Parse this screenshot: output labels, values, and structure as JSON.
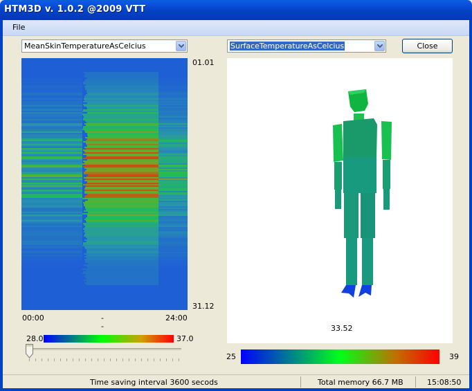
{
  "window": {
    "title": "HTM3D v. 1.0.2 @2009 VTT"
  },
  "menu": {
    "file": "File"
  },
  "left_panel": {
    "selector_value": "MeanSkinTemperatureAsCelcius",
    "date_start": "01.01",
    "date_end": "31.12",
    "time_start": "00:00",
    "time_mid": "-",
    "time_mid2": "-",
    "time_end": "24:00",
    "scale_min": "28.0",
    "scale_max": "37.0",
    "slider_position_percent": 0
  },
  "right_panel": {
    "selector_value": "SurfaceTemperatureAsCelcius",
    "close_label": "Close",
    "value_readout": "33.52",
    "scale_min": "25",
    "scale_max": "39"
  },
  "status": {
    "message": "Time saving interval 3600 secods",
    "memory": "Total memory 66.7 MB",
    "time": "15:08:50"
  },
  "colors": {
    "heat_low": "#1f5fd6",
    "heat_mid": "#22a85a",
    "heat_high": "#c25a18",
    "body_green": "#10b050",
    "body_teal": "#1a9a7a",
    "foot_blue": "#1040e0"
  }
}
